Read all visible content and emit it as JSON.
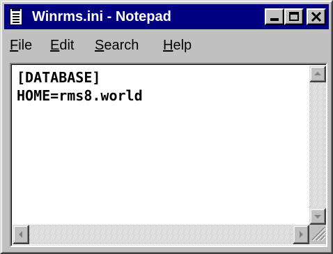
{
  "window": {
    "title": "Winrms.ini - Notepad",
    "icon": "notepad-icon",
    "titlebar_color": "#000080"
  },
  "menu": {
    "file": {
      "mnemonic": "F",
      "rest": "ile"
    },
    "edit": {
      "mnemonic": "E",
      "rest": "dit"
    },
    "search": {
      "mnemonic": "S",
      "rest": "earch"
    },
    "help": {
      "mnemonic": "H",
      "rest": "elp"
    }
  },
  "editor": {
    "lines": [
      "[DATABASE]",
      "HOME=rms8.world"
    ]
  },
  "icons": {
    "minimize": "minimize-icon",
    "maximize": "maximize-icon",
    "close": "close-icon",
    "scroll_up": "arrow-up-icon",
    "scroll_down": "arrow-down-icon",
    "scroll_left": "arrow-left-icon",
    "scroll_right": "arrow-right-icon",
    "size_grip": "size-grip-icon"
  }
}
